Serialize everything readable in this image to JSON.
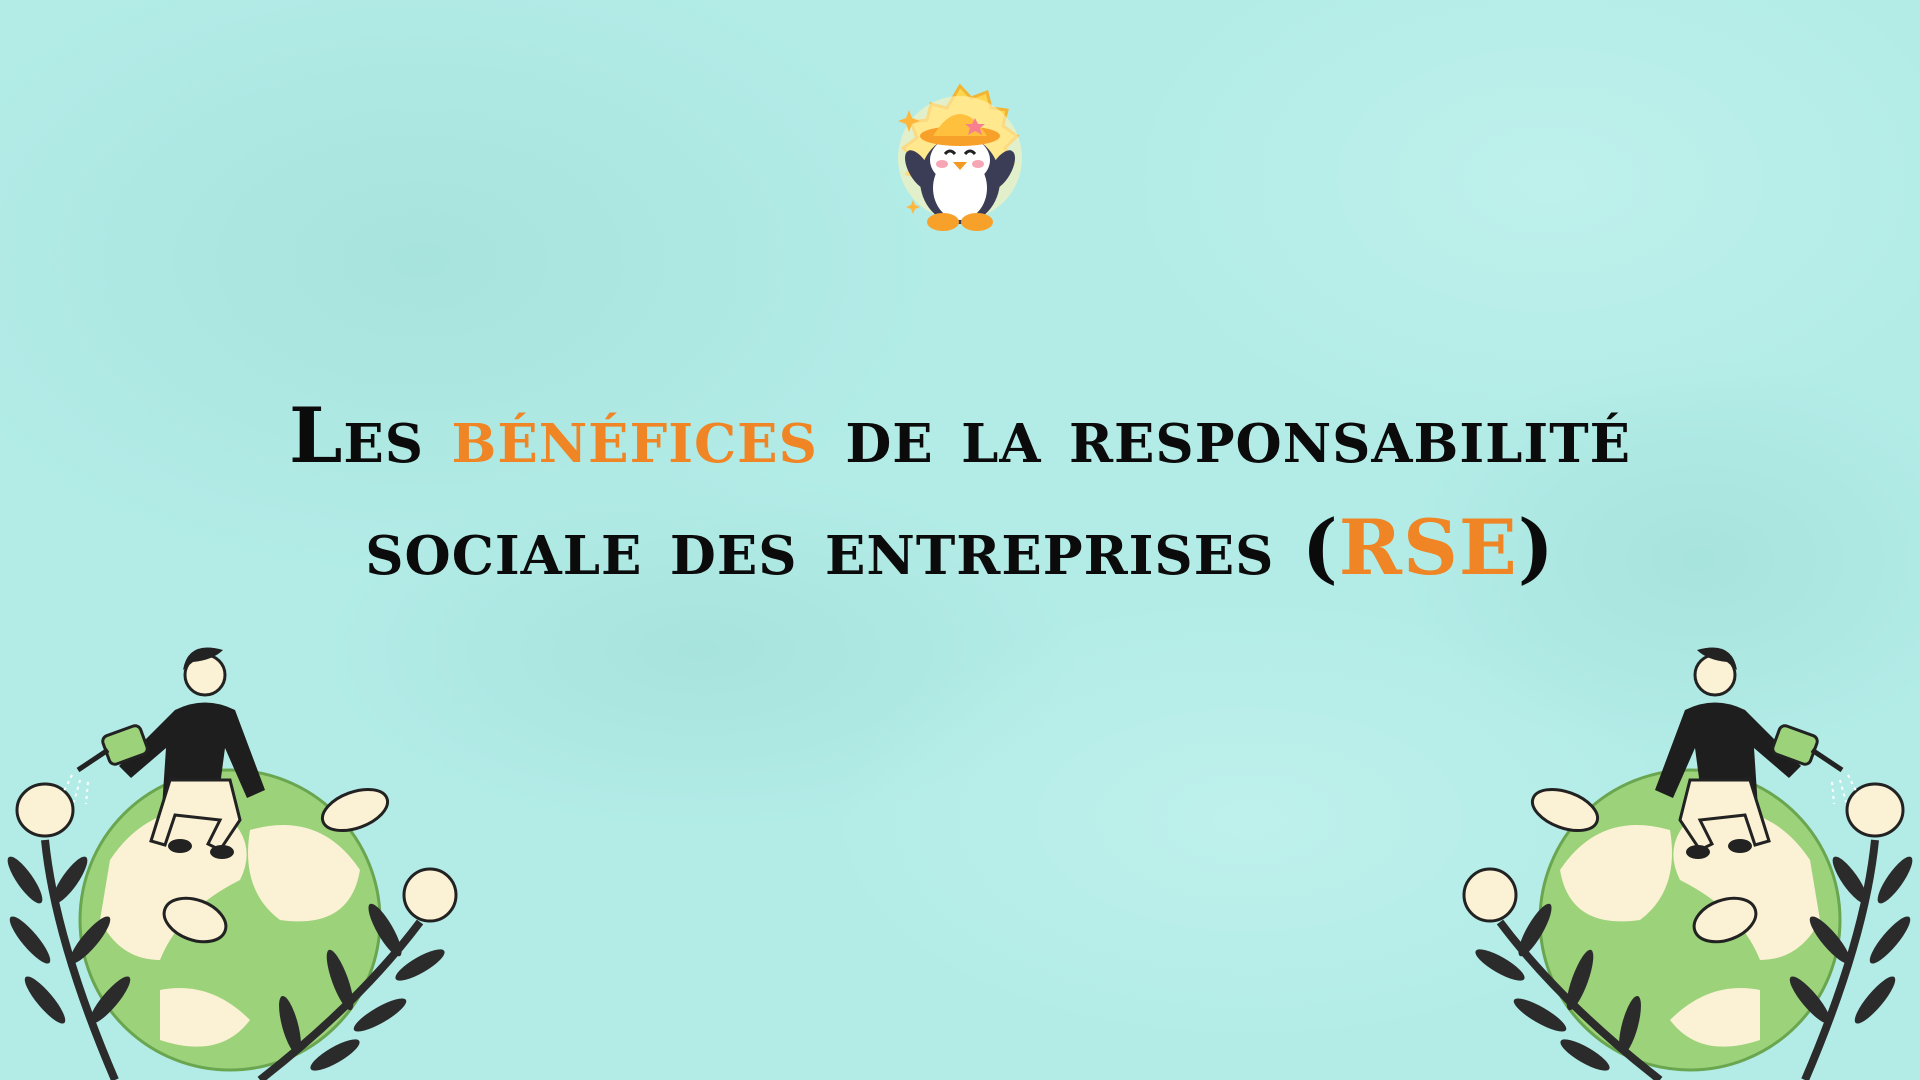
{
  "colors": {
    "background": "#b3ece7",
    "title_text": "#0b0b0b",
    "accent": "#ef8524",
    "globe_land": "#fbf1d4",
    "globe_green": "#9bd27a",
    "leaf": "#2b2b2b"
  },
  "icons": {
    "mascot": "penguin-mascot-icon",
    "left_illustration": "person-watering-globe-icon",
    "right_illustration": "person-watering-globe-icon"
  },
  "title": {
    "line1": {
      "word1": "Les",
      "highlight": "bénéfices",
      "rest": "de la responsabilité"
    },
    "line2": {
      "before": "sociale des entreprises (",
      "highlight": "RSE",
      "after": ")"
    }
  }
}
